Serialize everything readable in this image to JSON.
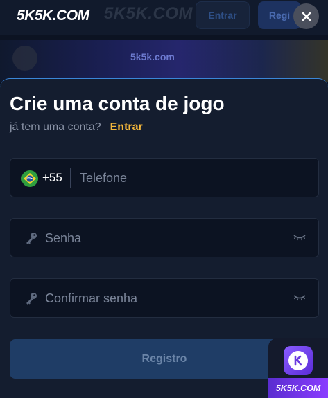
{
  "background": {
    "ghost_title": "5K5K.COM",
    "enter_label": "Entrar",
    "register_label": "Regi",
    "banner_text": "5k5k.com"
  },
  "logo": {
    "text": "5K5K.COM"
  },
  "close": {
    "icon": "close-icon",
    "glyph": "✕"
  },
  "form": {
    "title": "Crie uma conta de jogo",
    "subtitle": "já tem uma conta?",
    "login_link": "Entrar",
    "phone": {
      "dial_code": "+55",
      "placeholder": "Telefone",
      "flag": "brazil-flag-icon"
    },
    "password": {
      "placeholder": "Senha"
    },
    "confirm": {
      "placeholder": "Confirmar senha"
    },
    "submit_label": "Registro"
  },
  "app_badge": {
    "label": "5K5K.COM",
    "icon_letter": "K"
  },
  "colors": {
    "accent": "#f4b73b",
    "button": "#1f3d66",
    "sheet": "#141d2f"
  }
}
